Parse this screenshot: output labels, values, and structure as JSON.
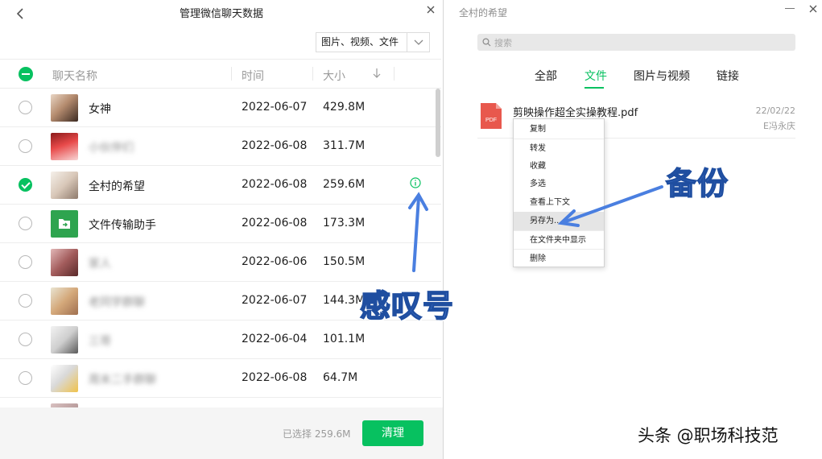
{
  "left_window": {
    "title": "管理微信聊天数据",
    "filter": {
      "selected": "图片、视频、文件"
    },
    "columns": {
      "name": "聊天名称",
      "time": "时间",
      "size": "大小"
    },
    "rows": [
      {
        "name": "女神",
        "date": "2022-06-07",
        "size": "429.8M",
        "checked": false,
        "blurred": false,
        "avatar": "photo"
      },
      {
        "name": "小伙伴们",
        "date": "2022-06-08",
        "size": "311.7M",
        "checked": false,
        "blurred": true,
        "avatar": "red"
      },
      {
        "name": "全村的希望",
        "date": "2022-06-08",
        "size": "259.6M",
        "checked": true,
        "blurred": false,
        "avatar": "group",
        "warning": true
      },
      {
        "name": "文件传输助手",
        "date": "2022-06-08",
        "size": "173.3M",
        "checked": false,
        "blurred": false,
        "avatar": "filehelper"
      },
      {
        "name": "家人",
        "date": "2022-06-06",
        "size": "150.5M",
        "checked": false,
        "blurred": true,
        "avatar": "rose"
      },
      {
        "name": "老同学群聊",
        "date": "2022-06-07",
        "size": "144.3M",
        "checked": false,
        "blurred": true,
        "avatar": "cartoon"
      },
      {
        "name": "三哥",
        "date": "2022-06-04",
        "size": "101.1M",
        "checked": false,
        "blurred": true,
        "avatar": "group2"
      },
      {
        "name": "周末二手群聊",
        "date": "2022-06-08",
        "size": "64.7M",
        "checked": false,
        "blurred": true,
        "avatar": "panda"
      },
      {
        "name": "",
        "date": "",
        "size": "",
        "checked": false,
        "blurred": true,
        "avatar": "partial"
      }
    ],
    "footer": {
      "selected_text": "已选择 259.6M",
      "clear_label": "清理"
    }
  },
  "right_window": {
    "title": "全村的希望",
    "search_placeholder": "搜索",
    "tabs": [
      "全部",
      "文件",
      "图片与视频",
      "链接"
    ],
    "active_tab": "文件",
    "file": {
      "name": "剪映操作超全实操教程.pdf",
      "icon_label": "PDF",
      "date": "22/02/22",
      "sender": "E冯永庆"
    },
    "context_menu": [
      "复制",
      "转发",
      "收藏",
      "多选",
      "查看上下文",
      "另存为...",
      "在文件夹中显示",
      "删除"
    ],
    "highlighted_item": "另存为..."
  },
  "annotations": {
    "backup": "备份",
    "exclamation": "感叹号",
    "arrow_color": "#5a8de8"
  },
  "watermark": "头条 @职场科技范",
  "colors": {
    "accent": "#07c160",
    "annotation": "#5a8de8"
  }
}
